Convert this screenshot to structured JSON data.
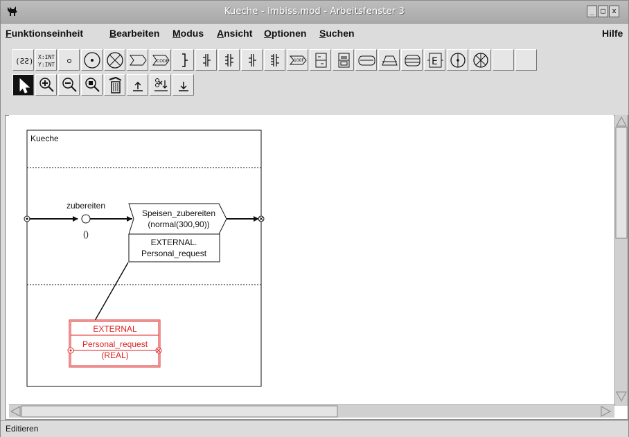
{
  "window": {
    "title": "Kueche - Imbiss.mod - Arbeitsfenster 3",
    "controls": {
      "minimize": "_",
      "maximize": "□",
      "close": "x"
    }
  },
  "menu": {
    "items": [
      {
        "label": "Funktionseinheit",
        "accel": "F"
      },
      {
        "label": "Bearbeiten",
        "accel": "B"
      },
      {
        "label": "Modus",
        "accel": "M"
      },
      {
        "label": "Ansicht",
        "accel": "A"
      },
      {
        "label": "Optionen",
        "accel": "O"
      },
      {
        "label": "Suchen",
        "accel": "S"
      }
    ],
    "help": "Hilfe"
  },
  "toolbar": {
    "row1_icons": [
      "lambda-signature-icon",
      "xy-int-icon",
      "small-circle-icon",
      "circle-dot-icon",
      "circle-cross-icon",
      "chevron-box-icon",
      "chevron-code-icon",
      "bracket-icon",
      "double-bracket-icon",
      "triple-bracket-icon",
      "bracket-pair-icon",
      "quad-bracket-icon",
      "chevron-100-icon",
      "split-box-icon",
      "split-box-alt-icon",
      "rounded-rect-icon",
      "trapezoid-icon",
      "stacked-rect-icon",
      "e-box-icon",
      "circle-plus-icon",
      "circle-star-icon",
      "blank-icon",
      "blank-icon"
    ],
    "xy_label_top": "X:INT",
    "xy_label_bottom": "Y:INT",
    "sig_label": "(ƧƧ)",
    "code_label": "CODE",
    "code100_label": "100F",
    "ebox_label": "E",
    "row2_icons": [
      "pointer-icon",
      "zoom-in-icon",
      "zoom-out-icon",
      "zoom-fit-icon",
      "trash-icon",
      "up-arrow-icon",
      "cut-down-icon",
      "down-arrow-icon"
    ]
  },
  "diagram": {
    "container_title": "Kueche",
    "edge_label": "zubereiten",
    "edge_value": "()",
    "process_name": "Speisen_zubereiten",
    "process_timing": "(normal(300,90))",
    "process_external_line1": "EXTERNAL.",
    "process_external_line2": "Personal_request",
    "resource_header": "EXTERNAL",
    "resource_name": "Personal_request",
    "resource_type": "(REAL)",
    "resource_color": "#dd2222"
  },
  "status": {
    "text": "Editieren"
  }
}
